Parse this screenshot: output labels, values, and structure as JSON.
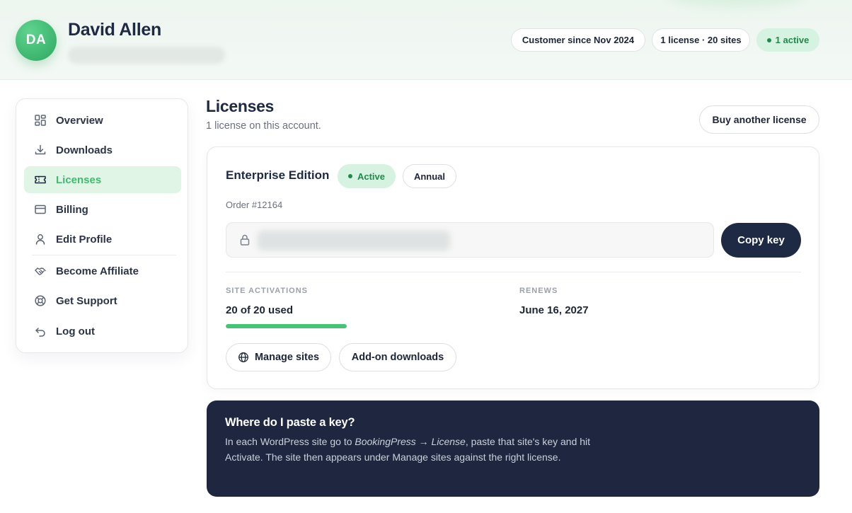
{
  "header": {
    "avatar_initials": "DA",
    "user_name": "David Allen",
    "chips": {
      "since": "Customer since Nov 2024",
      "licenses": "1 license · 20 sites",
      "active": "1 active"
    }
  },
  "sidebar": {
    "items": [
      {
        "label": "Overview",
        "icon": "grid-icon"
      },
      {
        "label": "Downloads",
        "icon": "download-icon"
      },
      {
        "label": "Licenses",
        "icon": "ticket-icon",
        "active": true
      },
      {
        "label": "Billing",
        "icon": "credit-card-icon"
      },
      {
        "label": "Edit Profile",
        "icon": "user-icon"
      },
      {
        "label": "Become Affiliate",
        "icon": "handshake-icon"
      },
      {
        "label": "Get Support",
        "icon": "lifebuoy-icon"
      },
      {
        "label": "Log out",
        "icon": "logout-icon"
      }
    ]
  },
  "main": {
    "title": "Licenses",
    "subtitle": "1 license on this account.",
    "buy_button": "Buy another license",
    "license": {
      "edition": "Enterprise Edition",
      "status": "Active",
      "term": "Annual",
      "order": "Order #12164",
      "copy_button": "Copy key",
      "activations_label": "SITE ACTIVATIONS",
      "activations_value": "20 of 20 used",
      "activations_used": 20,
      "activations_total": 20,
      "renews_label": "RENEWS",
      "renews_value": "June 16, 2027",
      "manage_button": "Manage sites",
      "addon_button": "Add-on downloads"
    },
    "help": {
      "title": "Where do I paste a key?",
      "body_prefix": "In each WordPress site go to ",
      "body_path": "BookingPress → License",
      "body_suffix": ", paste that site's key and hit Activate. The site then appears under Manage sites against the right license."
    }
  },
  "colors": {
    "accent": "#3fbb6c",
    "navy": "#1e2a44",
    "active_badge_bg": "#d6f2e0",
    "active_badge_text": "#1f8a4c"
  }
}
